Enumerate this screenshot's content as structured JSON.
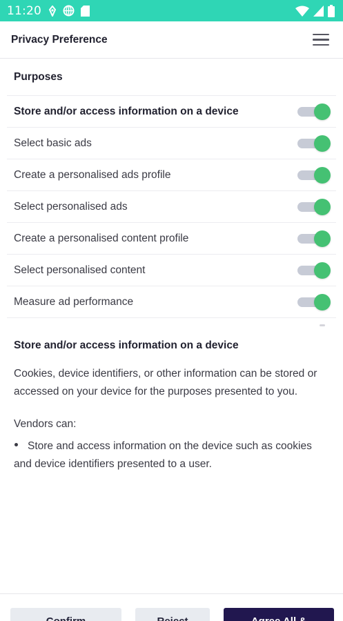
{
  "status_bar": {
    "time": "11:20",
    "background_color": "#2fd6b5",
    "left_icons": [
      "nfc-icon",
      "vpn-globe-icon",
      "sd-card-icon"
    ],
    "right_icons": [
      "wifi-icon",
      "cellular-signal-icon",
      "battery-icon"
    ]
  },
  "header": {
    "title": "Privacy Preference",
    "menu_icon": "hamburger-menu-icon"
  },
  "purposes": {
    "heading": "Purposes",
    "items": [
      {
        "label": "Store and/or access information on a device",
        "enabled": true,
        "bold": true
      },
      {
        "label": "Select basic ads",
        "enabled": true
      },
      {
        "label": "Create a personalised ads profile",
        "enabled": true
      },
      {
        "label": "Select personalised ads",
        "enabled": true
      },
      {
        "label": "Create a personalised content profile",
        "enabled": true
      },
      {
        "label": "Select personalised content",
        "enabled": true
      },
      {
        "label": "Measure ad performance",
        "enabled": true
      }
    ],
    "toggle_on_color": "#45c173",
    "toggle_track_color": "#c7cbd6"
  },
  "details": {
    "title": "Store and/or access information on a device",
    "description": "Cookies, device identifiers, or other information can be stored or accessed on your device for the purposes presented to you.",
    "vendors_label": "Vendors can:",
    "bullets": [
      "Store and access information on the device such as cookies and device identifiers presented to a user."
    ]
  },
  "footer": {
    "confirm_label": "Confirm",
    "reject_label": "Reject",
    "agree_label": "Agree All &",
    "primary_color": "#21174f",
    "secondary_color": "#e8ebf0"
  }
}
